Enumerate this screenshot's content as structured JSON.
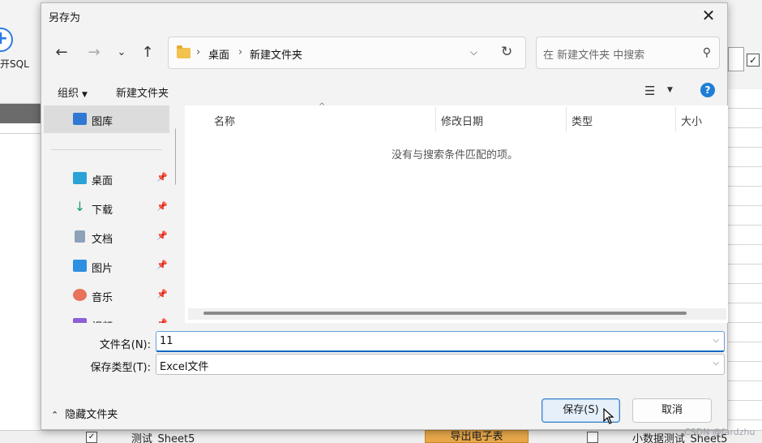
{
  "background_app": {
    "add_label": "开SQL",
    "row_name": "测试_Sheet5",
    "export_button": "导出电子表",
    "row_right_text": "小数据测试_Sheet5",
    "watermark": "CSDN @fardzhu"
  },
  "dialog": {
    "title": "另存为",
    "close_icon": "close-icon"
  },
  "navigation": {
    "back_icon": "←",
    "forward_icon": "→",
    "recent_icon": "⌄",
    "up_icon": "↑"
  },
  "address_bar": {
    "crumbs": [
      "桌面",
      "新建文件夹"
    ]
  },
  "search": {
    "placeholder": "在 新建文件夹 中搜索"
  },
  "command_bar": {
    "organize": "组织",
    "new_folder": "新建文件夹"
  },
  "sidebar": {
    "items": [
      {
        "label": "图库",
        "icon": "gallery-icon",
        "color": "#2f78d4",
        "pinned": false
      },
      {
        "label": "桌面",
        "icon": "desktop-icon",
        "color": "#29a3d6",
        "pinned": true
      },
      {
        "label": "下载",
        "icon": "download-icon",
        "color": "#1a9c6c",
        "pinned": true
      },
      {
        "label": "文档",
        "icon": "document-icon",
        "color": "#8da2b8",
        "pinned": true
      },
      {
        "label": "图片",
        "icon": "pictures-icon",
        "color": "#2f8fe0",
        "pinned": true
      },
      {
        "label": "音乐",
        "icon": "music-icon",
        "color": "#e8725a",
        "pinned": true
      },
      {
        "label": "视频",
        "icon": "video-icon",
        "color": "#8b5fd6",
        "pinned": true
      }
    ]
  },
  "file_list": {
    "columns": [
      "名称",
      "修改日期",
      "类型",
      "大小"
    ],
    "empty_message": "没有与搜索条件匹配的项。"
  },
  "form": {
    "filename_label": "文件名(N):",
    "filename_value": "11",
    "filetype_label": "保存类型(T):",
    "filetype_value": "Excel文件"
  },
  "footer": {
    "hide_folders": "隐藏文件夹",
    "save": "保存(S)",
    "cancel": "取消"
  },
  "colors": {
    "accent": "#0067c0",
    "help": "#1f7fd6"
  }
}
